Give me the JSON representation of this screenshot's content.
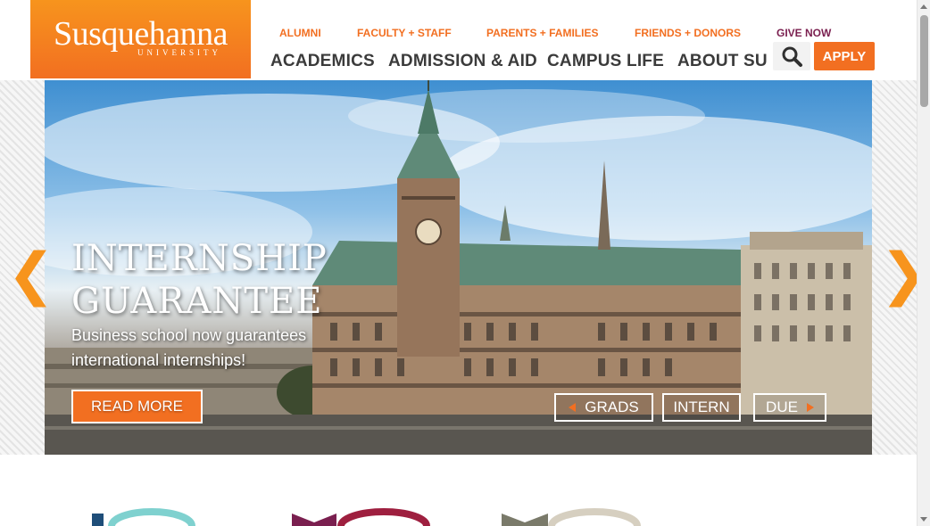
{
  "logo": {
    "name": "Susquehanna",
    "sub": "UNIVERSITY"
  },
  "util_nav": [
    "ALUMNI",
    "FACULTY + STAFF",
    "PARENTS + FAMILIES",
    "FRIENDS + DONORS",
    "GIVE NOW"
  ],
  "main_nav": [
    "ACADEMICS",
    "ADMISSION & AID",
    "CAMPUS LIFE",
    "ABOUT SU"
  ],
  "search": {
    "icon": "search-icon"
  },
  "apply_label": "APPLY",
  "hero": {
    "title_line1": "INTERNSHIP",
    "title_line2": "GUARANTEE",
    "subtitle": "Business school now guarantees international internships!",
    "read_more": "READ MORE",
    "prev_arrow": "❮",
    "next_arrow": "❯",
    "slide_prev": "GRADS",
    "slide_current": "INTERN",
    "slide_next": "DUE"
  },
  "colors": {
    "brand_orange": "#f26f21",
    "maroon": "#7a1f4f",
    "nav_text": "#3b3b3b"
  }
}
